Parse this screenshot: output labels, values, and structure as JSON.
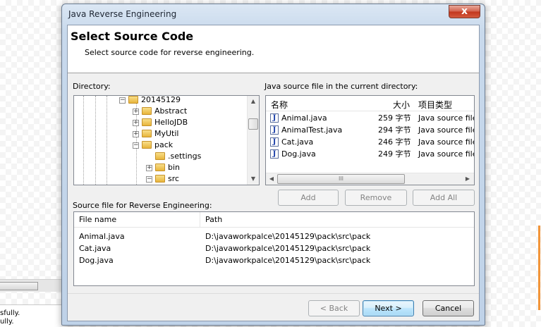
{
  "background": {
    "console_lines": [
      "sfully.",
      "ully."
    ]
  },
  "window": {
    "title": "Java Reverse Engineering",
    "close_glyph": "x"
  },
  "header": {
    "title": "Select Source Code",
    "subtitle": "Select source code for reverse engineering."
  },
  "directory": {
    "label": "Directory:",
    "tree": [
      {
        "name": "20145129",
        "expander": "−",
        "level": 0
      },
      {
        "name": "Abstract",
        "expander": "+",
        "level": 1
      },
      {
        "name": "HelloJDB",
        "expander": "+",
        "level": 1
      },
      {
        "name": "MyUtil",
        "expander": "+",
        "level": 1
      },
      {
        "name": "pack",
        "expander": "−",
        "level": 1
      },
      {
        "name": ".settings",
        "expander": "",
        "level": 2
      },
      {
        "name": "bin",
        "expander": "+",
        "level": 2
      },
      {
        "name": "src",
        "expander": "−",
        "level": 2
      }
    ],
    "scroll_up": "▲",
    "scroll_down": "▼"
  },
  "java_files": {
    "label": "Java source file in the current directory:",
    "columns": {
      "name": "名称",
      "size": "大小",
      "type": "项目类型"
    },
    "rows": [
      {
        "name": "Animal.java",
        "size": "259 字节",
        "type": "Java source file"
      },
      {
        "name": "AnimalTest.java",
        "size": "294 字节",
        "type": "Java source file"
      },
      {
        "name": "Cat.java",
        "size": "246 字节",
        "type": "Java source file"
      },
      {
        "name": "Dog.java",
        "size": "249 字节",
        "type": "Java source file"
      }
    ],
    "java_icon_glyph": "J",
    "scroll_left": "◀",
    "scroll_right": "▶",
    "thumb_grip": "III"
  },
  "actions": {
    "add": "Add",
    "remove": "Remove",
    "add_all": "Add All"
  },
  "source_files": {
    "label": "Source file for Reverse Engineering:",
    "columns": {
      "file": "File name",
      "path": "Path"
    },
    "rows": [
      {
        "file": "Animal.java",
        "path": "D:\\javaworkpalce\\20145129\\pack\\src\\pack"
      },
      {
        "file": "Cat.java",
        "path": "D:\\javaworkpalce\\20145129\\pack\\src\\pack"
      },
      {
        "file": "Dog.java",
        "path": "D:\\javaworkpalce\\20145129\\pack\\src\\pack"
      }
    ]
  },
  "footer": {
    "back": "< Back",
    "next": "Next >",
    "cancel": "Cancel"
  }
}
